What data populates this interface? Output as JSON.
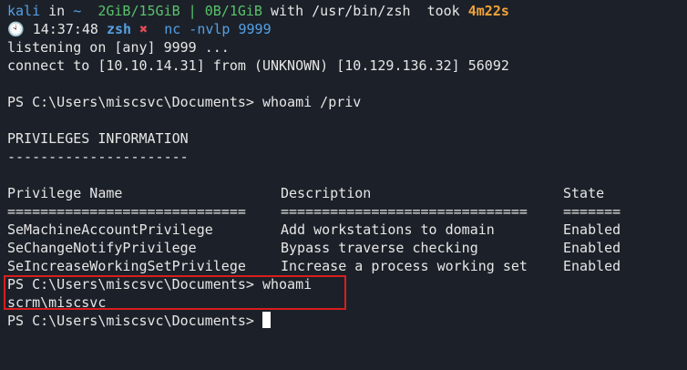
{
  "prompt": {
    "user": "kali",
    "in_word": "in",
    "dir": "~",
    "memory": "2GiB/15GiB | 0B/1GiB",
    "with_text": "with /usr/bin/zsh",
    "took_word": "took",
    "duration": "4m22s",
    "clock_icon": "clock-icon",
    "time": "14:37:48",
    "shell": "zsh",
    "status_mark": "✖",
    "command": "nc -nvlp 9999"
  },
  "output": {
    "listening": "listening on [any] 9999 ...",
    "connect": "connect to [10.10.14.31] from (UNKNOWN) [10.129.136.32] 56092",
    "ps1_cmd1": "PS C:\\Users\\miscsvc\\Documents> whoami /priv",
    "priv_header": "PRIVILEGES INFORMATION",
    "priv_underline": "----------------------",
    "ps2_cmd": "PS C:\\Users\\miscsvc\\Documents> whoami",
    "whoami_result": "scrm\\miscsvc",
    "ps3": "PS C:\\Users\\miscsvc\\Documents> "
  },
  "table": {
    "headers": [
      "Privilege Name",
      "Description",
      "State"
    ],
    "separators": [
      "=============================",
      "==============================",
      "======="
    ],
    "rows": [
      [
        "SeMachineAccountPrivilege",
        "Add workstations to domain",
        "Enabled"
      ],
      [
        "SeChangeNotifyPrivilege",
        "Bypass traverse checking",
        "Enabled"
      ],
      [
        "SeIncreaseWorkingSetPrivilege",
        "Increase a process working set",
        "Enabled"
      ]
    ]
  },
  "colors": {
    "background": "#1c2129",
    "text": "#e6e6e6",
    "accent_blue": "#56a0e3",
    "accent_green": "#59c26b",
    "accent_orange": "#f0a33a",
    "error_red": "#e04b57",
    "highlight_border": "#d81e1e"
  }
}
